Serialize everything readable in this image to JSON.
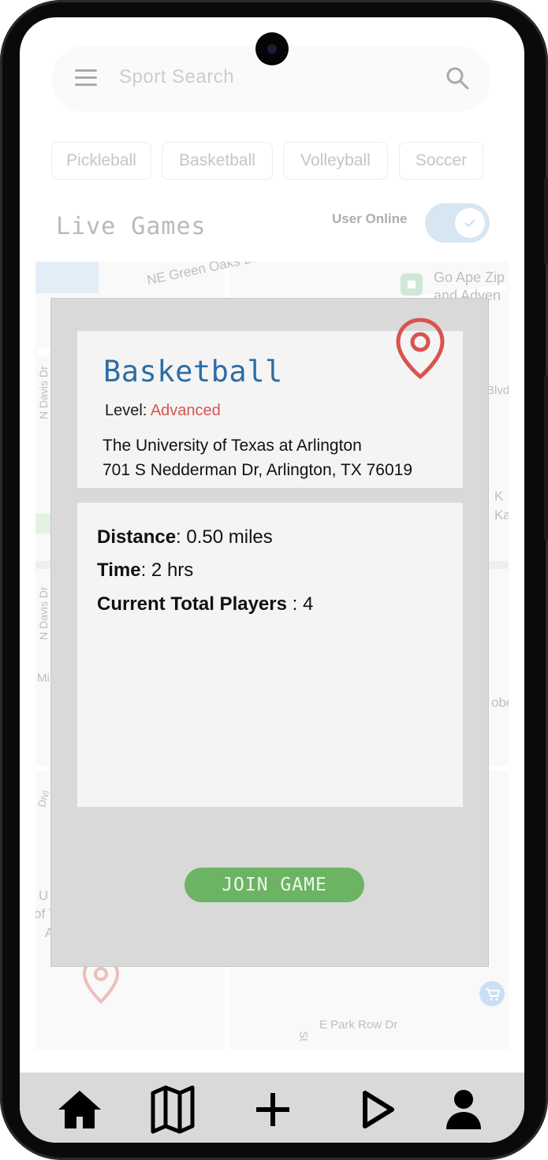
{
  "search": {
    "placeholder": "Sport Search"
  },
  "chips": [
    {
      "label": "Pickleball"
    },
    {
      "label": "Basketball"
    },
    {
      "label": "Volleyball"
    },
    {
      "label": "Soccer"
    }
  ],
  "header": {
    "title": "Live Games",
    "online_label": "User Online",
    "online": true
  },
  "map": {
    "labels": [
      "NE Green Oaks Blvd",
      "Go Ape Zip",
      "and Adven",
      "Blvd",
      "N Davis Dr",
      "N Davis Dr",
      "Mi",
      "K",
      "Ka",
      "obe",
      "E Park Row Dr",
      "St",
      "St",
      "U",
      "of T",
      "A",
      "Divi"
    ]
  },
  "game": {
    "sport": "Basketball",
    "level_label": "Level:",
    "level_value": "Advanced",
    "venue_name": "The University of Texas at Arlington",
    "venue_address": "701 S Nedderman Dr, Arlington, TX 76019",
    "distance_label": "Distance",
    "distance_value": ": 0.50 miles",
    "time_label": "Time",
    "time_value": ": 2 hrs",
    "players_label": "Current Total Players",
    "players_value": " : 4",
    "join_label": "JOIN GAME"
  },
  "colors": {
    "accent_blue": "#2e6da4",
    "level_red": "#d9534f",
    "join_green": "#6cb463",
    "nav_bg": "#d9d9d9"
  },
  "nav": [
    {
      "icon": "home-icon"
    },
    {
      "icon": "map-icon"
    },
    {
      "icon": "plus-icon"
    },
    {
      "icon": "play-icon"
    },
    {
      "icon": "user-icon"
    }
  ]
}
